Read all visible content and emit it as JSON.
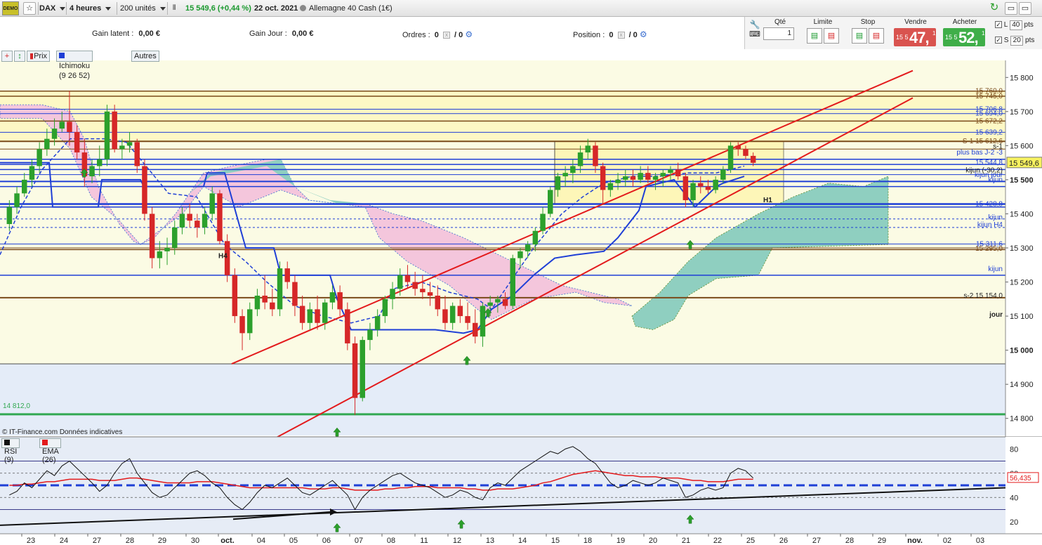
{
  "toolbar": {
    "demo_label": "DEMO",
    "instrument": "DAX",
    "period": "4 heures",
    "units": "200 unités",
    "price_change": "15 549,6 (+0,44 %)",
    "date": "22 oct. 2021",
    "market_name": "Allemagne 40 Cash (1€)"
  },
  "info": {
    "gain_latent_label": "Gain latent :",
    "gain_latent_value": "0,00 €",
    "gain_jour_label": "Gain Jour :",
    "gain_jour_value": "0,00 €",
    "ordres_label": "Ordres :",
    "ordres_value_a": "0",
    "ordres_value_b": "/ 0",
    "position_label": "Position :",
    "position_value_a": "0",
    "position_value_b": "/ 0"
  },
  "order_panel": {
    "qte_label": "Qté",
    "qte_value": "1",
    "limite_label": "Limite",
    "stop_label": "Stop",
    "vendre_label": "Vendre",
    "vendre_prefix": "15 5",
    "vendre_big": "47,",
    "vendre_sup": "1",
    "acheter_label": "Acheter",
    "acheter_prefix": "15 5",
    "acheter_big": "52,",
    "acheter_sup": "1",
    "l_label": "L",
    "l_value": "40",
    "s_label": "S",
    "s_value": "20",
    "pts": "pts"
  },
  "legend": {
    "prix": "Prix",
    "ichimoku": "Ichimoku (9 26 52)",
    "autres": "Autres"
  },
  "price_axis": {
    "ticks": [
      "15 800",
      "15 700",
      "15 600",
      "15 500",
      "15 400",
      "15 300",
      "15 200",
      "15 100",
      "15 000",
      "14 900",
      "14 800"
    ],
    "current_price": "15 549,6"
  },
  "level_labels": {
    "l1": "15 760,0",
    "l2": "15 745,0",
    "l3": "15 706,8",
    "l4": "15 694,0",
    "l5": "15 672,2",
    "l6": "15 639,2",
    "l7": "S-1 15 612,6",
    "l8": "s-1",
    "l9": "plus bas J-2 -3",
    "l10": "15 544,8",
    "l11": "kijun (-30,2)",
    "l12": "kijun jour",
    "l13": "kijun",
    "l14": "15 428,8",
    "l15": "kijun",
    "l16": "kijun H4",
    "l17": "15 311,6",
    "l18": "15 295,0",
    "l19": "kijun",
    "l20": "s-2 15 154,0",
    "l21": "jour",
    "l22": "14 812,0",
    "h1": "H1",
    "h4": "H4"
  },
  "credit": "© IT-Finance.com Données indicatives",
  "rsi_legend": {
    "rsi": "RSI (9)",
    "ema": "EMA (26)"
  },
  "rsi_axis": {
    "ticks": [
      "80",
      "60",
      "40",
      "20"
    ],
    "current": "56,435"
  },
  "date_axis": [
    "23",
    "24",
    "27",
    "28",
    "29",
    "30",
    "oct.",
    "04",
    "05",
    "06",
    "07",
    "08",
    "11",
    "12",
    "13",
    "14",
    "15",
    "18",
    "19",
    "20",
    "21",
    "22",
    "25",
    "26",
    "27",
    "28",
    "29",
    "nov.",
    "02",
    "03"
  ],
  "colors": {
    "bull": "#2ca02c",
    "bear": "#d62728",
    "channel": "#e31a1c",
    "kijun": "#1f3fd6",
    "cloud_bull": "#8fcfc0",
    "cloud_bear": "#f4c6dc",
    "support": "#32a852"
  },
  "chart_data": {
    "type": "candlestick",
    "title": "DAX 4 heures",
    "ylim": [
      14750,
      15850
    ],
    "x_first": "23",
    "x_last": "03",
    "last_price": 15549.6,
    "ohlc": [
      [
        15370,
        15440,
        15350,
        15420
      ],
      [
        15420,
        15480,
        15400,
        15460
      ],
      [
        15460,
        15520,
        15450,
        15500
      ],
      [
        15500,
        15560,
        15480,
        15540
      ],
      [
        15540,
        15610,
        15520,
        15590
      ],
      [
        15590,
        15650,
        15570,
        15620
      ],
      [
        15620,
        15680,
        15600,
        15650
      ],
      [
        15650,
        15700,
        15640,
        15670
      ],
      [
        15670,
        15760,
        15600,
        15640
      ],
      [
        15640,
        15660,
        15560,
        15580
      ],
      [
        15580,
        15620,
        15480,
        15510
      ],
      [
        15510,
        15560,
        15490,
        15540
      ],
      [
        15540,
        15600,
        15510,
        15560
      ],
      [
        15560,
        15720,
        15540,
        15700
      ],
      [
        15700,
        15720,
        15580,
        15590
      ],
      [
        15590,
        15620,
        15560,
        15600
      ],
      [
        15600,
        15640,
        15580,
        15610
      ],
      [
        15610,
        15620,
        15520,
        15540
      ],
      [
        15540,
        15560,
        15380,
        15400
      ],
      [
        15400,
        15420,
        15240,
        15270
      ],
      [
        15270,
        15320,
        15240,
        15290
      ],
      [
        15290,
        15330,
        15250,
        15300
      ],
      [
        15300,
        15380,
        15280,
        15360
      ],
      [
        15360,
        15420,
        15340,
        15400
      ],
      [
        15400,
        15430,
        15360,
        15380
      ],
      [
        15380,
        15400,
        15330,
        15360
      ],
      [
        15360,
        15420,
        15340,
        15400
      ],
      [
        15400,
        15480,
        15380,
        15460
      ],
      [
        15460,
        15470,
        15310,
        15320
      ],
      [
        15320,
        15340,
        15200,
        15220
      ],
      [
        15220,
        15240,
        15080,
        15100
      ],
      [
        15100,
        15120,
        15000,
        15050
      ],
      [
        15050,
        15140,
        15030,
        15120
      ],
      [
        15120,
        15180,
        15100,
        15160
      ],
      [
        15160,
        15220,
        15120,
        15140
      ],
      [
        15140,
        15180,
        15100,
        15120
      ],
      [
        15120,
        15260,
        15100,
        15240
      ],
      [
        15240,
        15260,
        15180,
        15200
      ],
      [
        15200,
        15220,
        15100,
        15130
      ],
      [
        15130,
        15160,
        15060,
        15080
      ],
      [
        15080,
        15140,
        15060,
        15120
      ],
      [
        15120,
        15160,
        15060,
        15080
      ],
      [
        15080,
        15150,
        15060,
        15140
      ],
      [
        15140,
        15190,
        15120,
        15170
      ],
      [
        15170,
        15190,
        15100,
        15120
      ],
      [
        15120,
        15140,
        15000,
        15020
      ],
      [
        15020,
        15040,
        14810,
        14860
      ],
      [
        14860,
        15040,
        14850,
        15030
      ],
      [
        15030,
        15080,
        15000,
        15060
      ],
      [
        15060,
        15120,
        15040,
        15100
      ],
      [
        15100,
        15160,
        15080,
        15150
      ],
      [
        15150,
        15200,
        15120,
        15180
      ],
      [
        15180,
        15240,
        15160,
        15220
      ],
      [
        15220,
        15250,
        15180,
        15200
      ],
      [
        15200,
        15230,
        15160,
        15180
      ],
      [
        15180,
        15220,
        15150,
        15170
      ],
      [
        15170,
        15200,
        15130,
        15160
      ],
      [
        15160,
        15190,
        15100,
        15120
      ],
      [
        15120,
        15160,
        15060,
        15080
      ],
      [
        15080,
        15140,
        15060,
        15130
      ],
      [
        15130,
        15150,
        15080,
        15100
      ],
      [
        15100,
        15140,
        15060,
        15080
      ],
      [
        15080,
        15120,
        15020,
        15040
      ],
      [
        15040,
        15140,
        15010,
        15130
      ],
      [
        15130,
        15160,
        15100,
        15140
      ],
      [
        15140,
        15160,
        15110,
        15150
      ],
      [
        15150,
        15170,
        15120,
        15130
      ],
      [
        15130,
        15280,
        15120,
        15270
      ],
      [
        15270,
        15300,
        15240,
        15290
      ],
      [
        15290,
        15320,
        15270,
        15310
      ],
      [
        15310,
        15360,
        15290,
        15350
      ],
      [
        15350,
        15420,
        15340,
        15400
      ],
      [
        15400,
        15480,
        15390,
        15470
      ],
      [
        15470,
        15520,
        15450,
        15510
      ],
      [
        15510,
        15540,
        15480,
        15520
      ],
      [
        15520,
        15560,
        15490,
        15540
      ],
      [
        15540,
        15600,
        15520,
        15580
      ],
      [
        15580,
        15620,
        15560,
        15600
      ],
      [
        15600,
        15610,
        15520,
        15540
      ],
      [
        15540,
        15550,
        15430,
        15470
      ],
      [
        15470,
        15500,
        15450,
        15490
      ],
      [
        15490,
        15520,
        15470,
        15500
      ],
      [
        15500,
        15530,
        15480,
        15510
      ],
      [
        15510,
        15530,
        15480,
        15500
      ],
      [
        15500,
        15540,
        15490,
        15520
      ],
      [
        15520,
        15540,
        15490,
        15500
      ],
      [
        15500,
        15520,
        15470,
        15510
      ],
      [
        15510,
        15530,
        15480,
        15520
      ],
      [
        15520,
        15540,
        15500,
        15530
      ],
      [
        15530,
        15550,
        15500,
        15510
      ],
      [
        15510,
        15520,
        15420,
        15440
      ],
      [
        15440,
        15500,
        15420,
        15490
      ],
      [
        15490,
        15510,
        15460,
        15480
      ],
      [
        15480,
        15500,
        15460,
        15470
      ],
      [
        15470,
        15510,
        15460,
        15500
      ],
      [
        15500,
        15540,
        15490,
        15530
      ],
      [
        15530,
        15610,
        15520,
        15600
      ],
      [
        15600,
        15610,
        15570,
        15590
      ],
      [
        15590,
        15600,
        15560,
        15570
      ],
      [
        15570,
        15580,
        15540,
        15549.6
      ]
    ],
    "horizontal_levels": [
      15760.0,
      15745.0,
      15706.8,
      15694.0,
      15672.2,
      15639.2,
      15612.6,
      15544.8,
      15428.8,
      15311.6,
      15295.0,
      15154.0,
      14812.0
    ],
    "rsi": {
      "name": "RSI (9)",
      "ylim": [
        10,
        90
      ],
      "last": 56.435,
      "values": [
        42,
        45,
        52,
        48,
        55,
        62,
        58,
        66,
        70,
        64,
        58,
        52,
        45,
        50,
        60,
        68,
        72,
        60,
        52,
        44,
        40,
        42,
        48,
        54,
        60,
        62,
        58,
        52,
        48,
        40,
        34,
        30,
        36,
        44,
        50,
        48,
        52,
        56,
        50,
        44,
        42,
        46,
        50,
        54,
        48,
        42,
        30,
        40,
        46,
        50,
        54,
        58,
        60,
        56,
        52,
        50,
        48,
        44,
        40,
        42,
        46,
        44,
        40,
        38,
        48,
        52,
        50,
        56,
        62,
        66,
        70,
        74,
        78,
        76,
        80,
        82,
        78,
        72,
        68,
        60,
        52,
        48,
        50,
        54,
        52,
        50,
        52,
        56,
        54,
        52,
        40,
        42,
        46,
        48,
        46,
        48,
        60,
        64,
        62,
        56
      ]
    },
    "rsi_ema": {
      "name": "EMA (26)",
      "values": [
        50,
        50,
        51,
        51,
        52,
        53,
        53,
        54,
        55,
        55,
        55,
        55,
        54,
        54,
        54,
        55,
        56,
        56,
        55,
        54,
        53,
        52,
        52,
        52,
        52,
        53,
        53,
        53,
        52,
        51,
        50,
        49,
        48,
        48,
        48,
        48,
        48,
        48,
        48,
        48,
        47,
        47,
        47,
        48,
        48,
        47,
        46,
        46,
        46,
        46,
        47,
        47,
        48,
        48,
        49,
        49,
        49,
        48,
        48,
        48,
        48,
        47,
        47,
        46,
        46,
        47,
        47,
        47,
        48,
        49,
        50,
        52,
        53,
        55,
        57,
        59,
        60,
        61,
        62,
        61,
        60,
        59,
        58,
        58,
        57,
        57,
        57,
        56,
        56,
        56,
        55,
        54,
        54,
        53,
        53,
        53,
        54,
        55,
        55,
        55
      ]
    }
  }
}
